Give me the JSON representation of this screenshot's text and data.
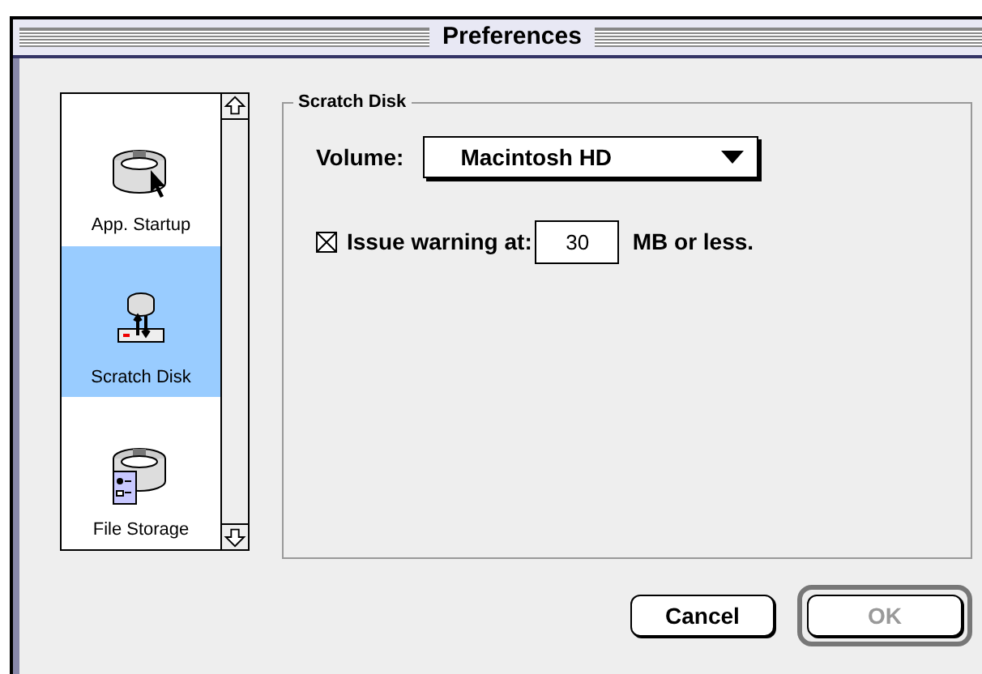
{
  "window": {
    "title": "Preferences"
  },
  "sidebar": {
    "items": [
      {
        "label": "App. Startup",
        "kind": "startup",
        "selected": false
      },
      {
        "label": "Scratch Disk",
        "kind": "scratch",
        "selected": true
      },
      {
        "label": "File Storage",
        "kind": "storage",
        "selected": false
      }
    ]
  },
  "group": {
    "title": "Scratch Disk",
    "volume": {
      "label": "Volume:",
      "value": "Macintosh HD"
    },
    "warning": {
      "checked": true,
      "label": "Issue warning at:",
      "value": "30",
      "suffix": "MB or less."
    }
  },
  "buttons": [
    {
      "label": "Cancel",
      "disabled": false,
      "default": false
    },
    {
      "label": "OK",
      "disabled": true,
      "default": true
    }
  ]
}
